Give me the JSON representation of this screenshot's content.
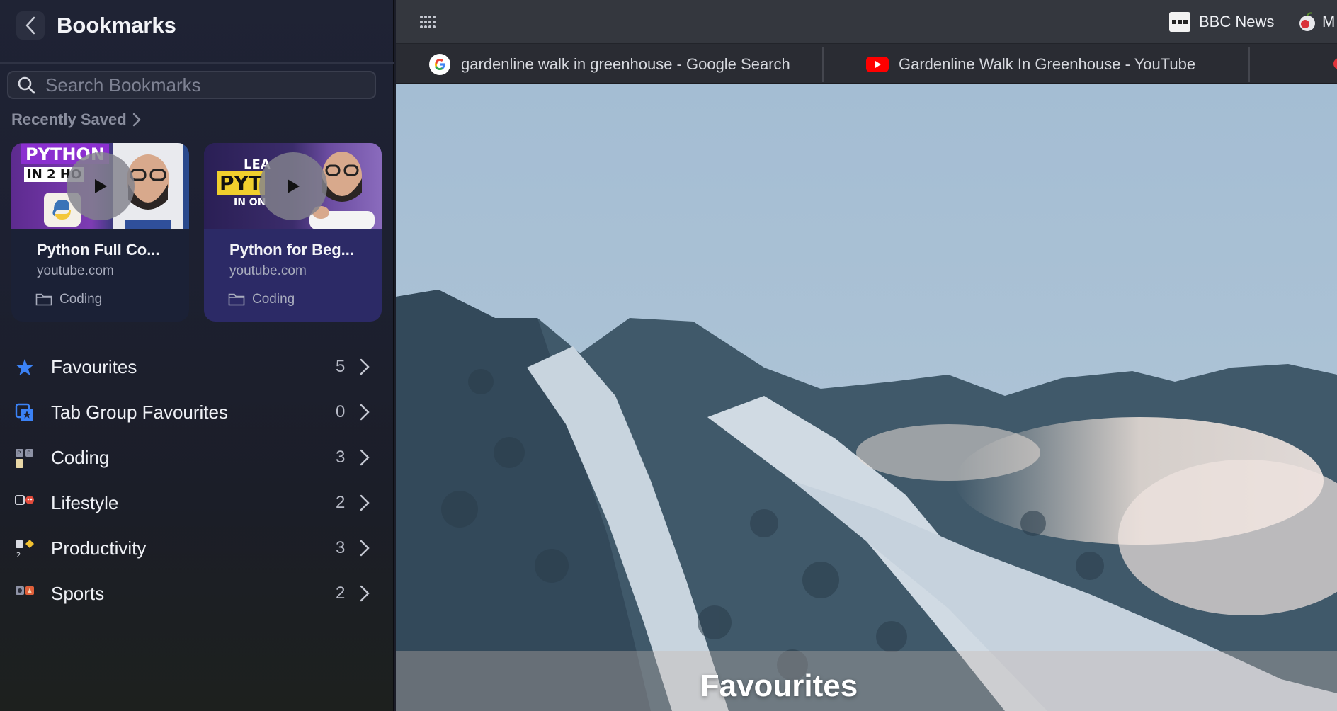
{
  "sidebar": {
    "title": "Bookmarks",
    "search_placeholder": "Search Bookmarks",
    "recently_saved_label": "Recently Saved",
    "cards": [
      {
        "thumb_text_1": "PYTHON",
        "thumb_text_2": "IN 2 HO",
        "title": "Python Full Co...",
        "site": "youtube.com",
        "folder": "Coding"
      },
      {
        "thumb_text_1": "LEA",
        "thumb_text_2": "PYT",
        "thumb_text_3": "IN ON",
        "title": "Python for Beg...",
        "site": "youtube.com",
        "folder": "Coding"
      }
    ],
    "folders": [
      {
        "label": "Favourites",
        "count": "5",
        "icon": "star-icon"
      },
      {
        "label": "Tab Group Favourites",
        "count": "0",
        "icon": "tab-group-icon"
      },
      {
        "label": "Coding",
        "count": "3",
        "icon": "coding-folder-icon"
      },
      {
        "label": "Lifestyle",
        "count": "2",
        "icon": "lifestyle-folder-icon"
      },
      {
        "label": "Productivity",
        "count": "3",
        "icon": "productivity-folder-icon"
      },
      {
        "label": "Sports",
        "count": "2",
        "icon": "sports-folder-icon"
      }
    ]
  },
  "toolbar": {
    "bookmark_1": "BBC News",
    "bookmark_2": "M"
  },
  "tabs": [
    {
      "title": "gardenline walk in greenhouse - Google Search",
      "icon": "google-icon"
    },
    {
      "title": "Gardenline Walk In Greenhouse - YouTube",
      "icon": "youtube-icon"
    }
  ],
  "main": {
    "heading": "Favourites"
  },
  "colors": {
    "accent_blue": "#3b82f6",
    "youtube_red": "#ff0000"
  }
}
